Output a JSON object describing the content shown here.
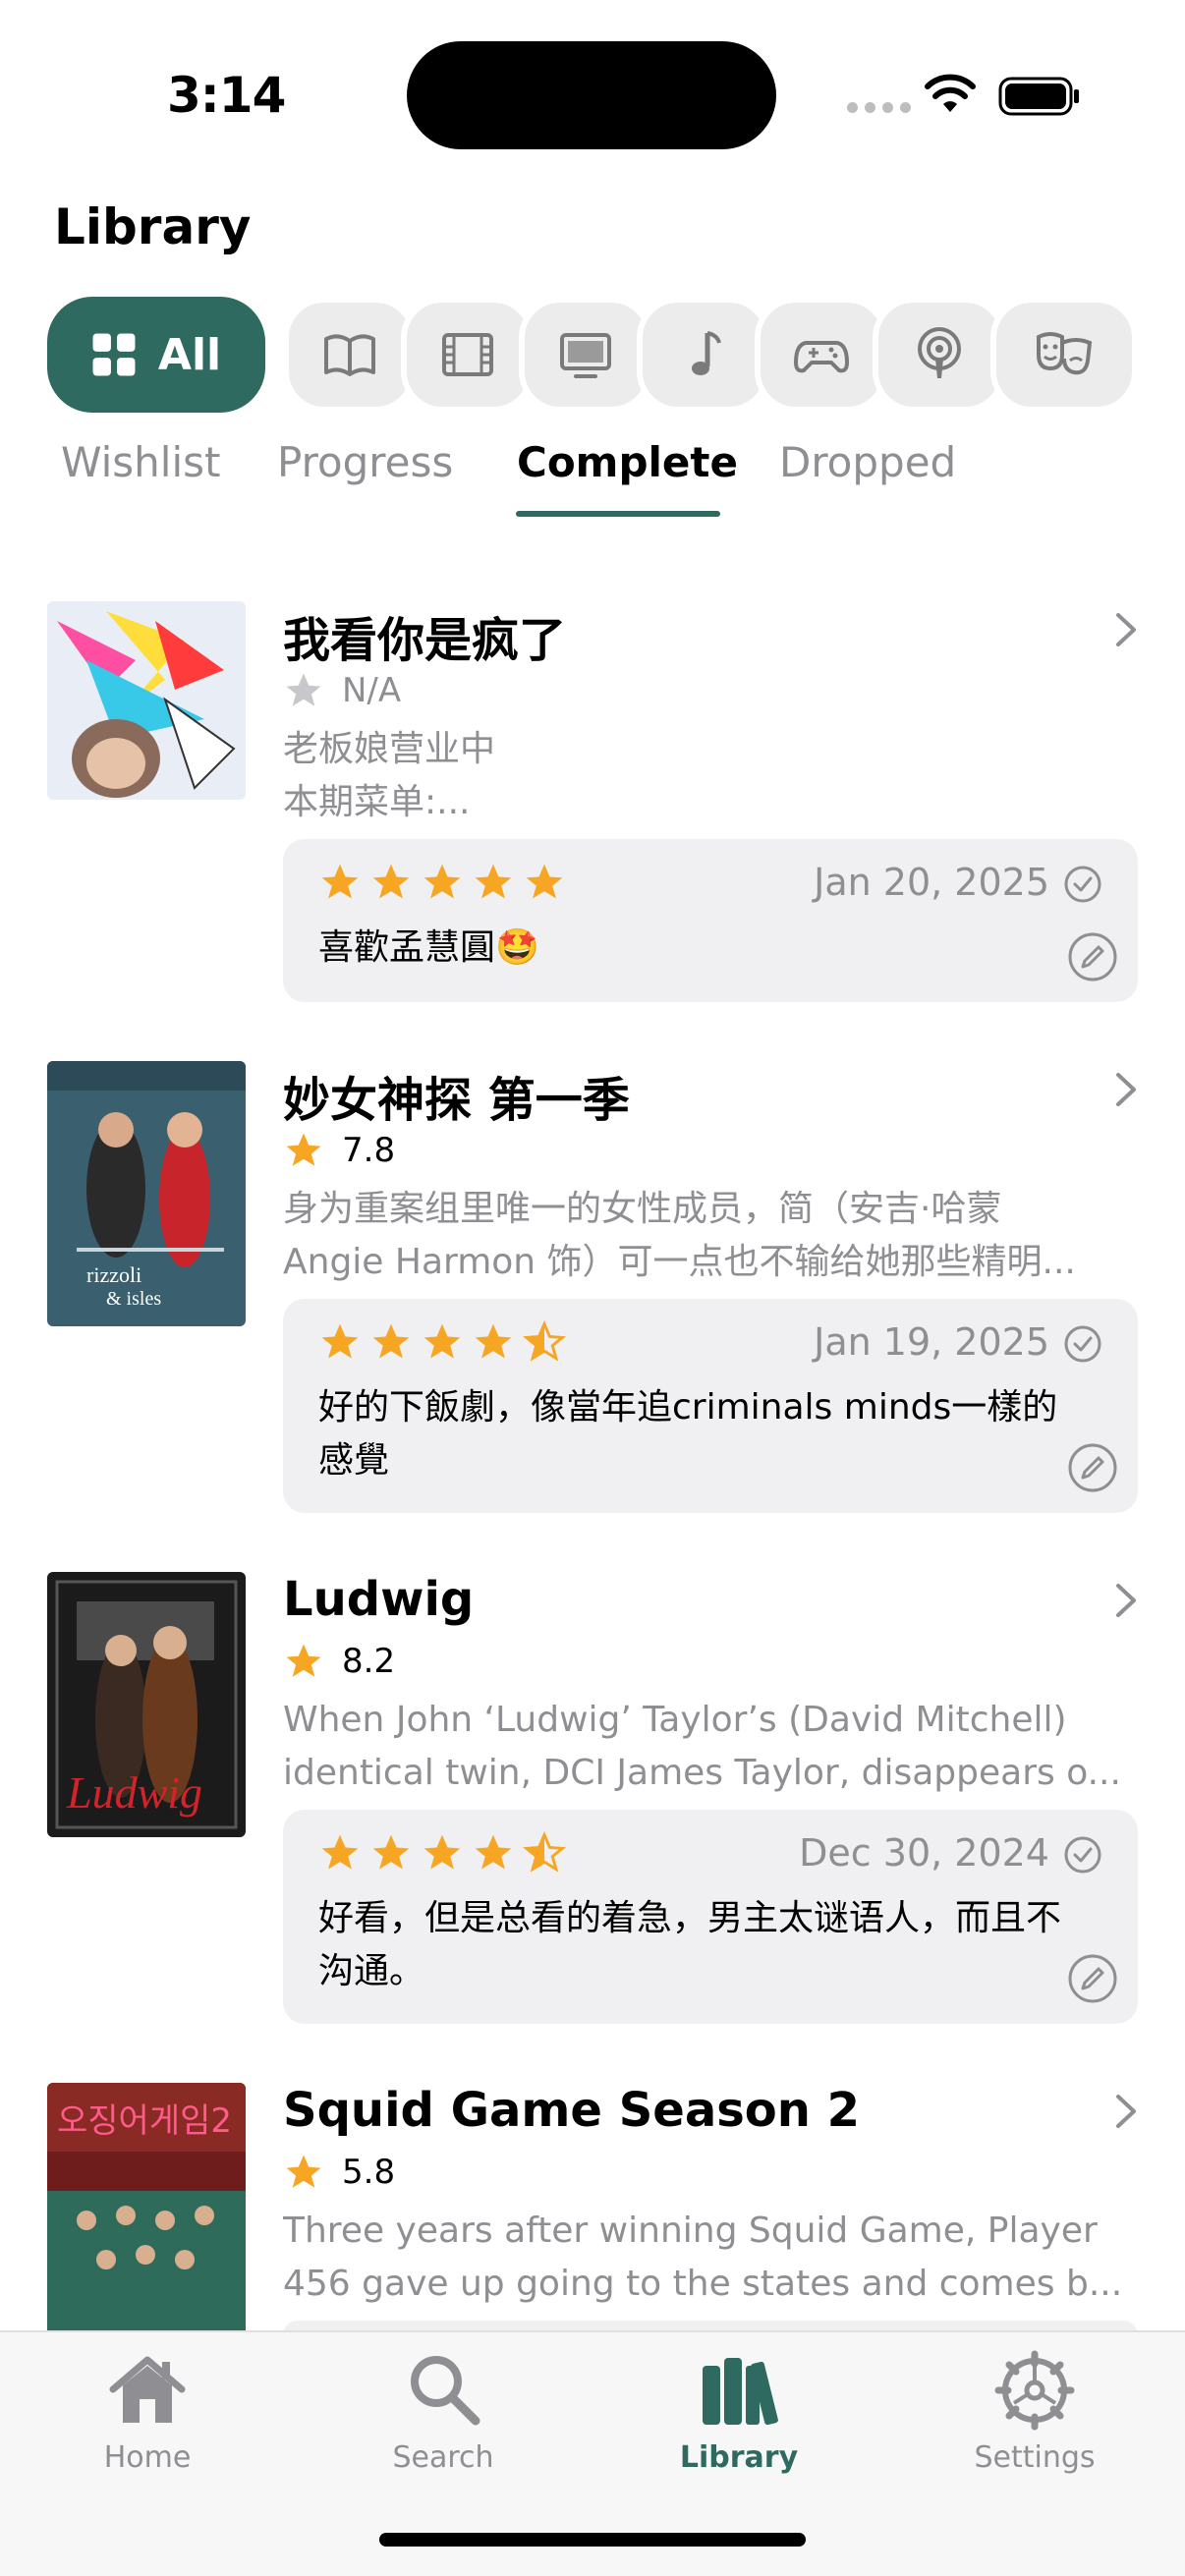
{
  "status_bar": {
    "time": "3:14"
  },
  "header": {
    "title": "Library"
  },
  "categories": {
    "all_label": "All",
    "items": [
      "book-icon",
      "film-icon",
      "tv-icon",
      "music-icon",
      "game-icon",
      "podcast-icon",
      "theater-icon"
    ]
  },
  "tabs": [
    "Wishlist",
    "Progress",
    "Complete",
    "Dropped"
  ],
  "active_tab": "Complete",
  "accent_color": "#2e6a5f",
  "star_color": "#f6a623",
  "items": [
    {
      "title": "我看你是疯了",
      "rating": "N/A",
      "desc_lines": [
        "老板娘营业中",
        "本期菜单:..."
      ],
      "review": {
        "stars": 5,
        "date": "Jan 20, 2025",
        "text": "喜歡孟慧圓🤩"
      }
    },
    {
      "title": "妙女神探 第一季",
      "rating": "7.8",
      "desc_lines": [
        "身为重案组里唯一的女性成员，简（安吉·哈蒙",
        "Angie Harmon 饰）可一点也不输给她那些精明..."
      ],
      "review": {
        "stars": 4.5,
        "date": "Jan 19, 2025",
        "text": "好的下飯劇，像當年追criminals minds一樣的感覺"
      }
    },
    {
      "title": "Ludwig",
      "rating": "8.2",
      "desc_lines": [
        "When John ‘Ludwig’ Taylor’s (David Mitchell)",
        "identical twin, DCI James Taylor, disappears o..."
      ],
      "review": {
        "stars": 4.5,
        "date": "Dec 30, 2024",
        "text": "好看，但是总看的着急，男主太谜语人，而且不沟通。"
      }
    },
    {
      "title": "Squid Game Season 2",
      "rating": "5.8",
      "desc_lines": [
        "Three years after winning Squid Game, Player",
        "456 gave up going to the states and comes b..."
      ]
    }
  ],
  "tabbar": {
    "items": [
      {
        "label": "Home",
        "icon": "house-icon"
      },
      {
        "label": "Search",
        "icon": "magnifier-icon"
      },
      {
        "label": "Library",
        "icon": "books-icon"
      },
      {
        "label": "Settings",
        "icon": "gear-icon"
      }
    ],
    "active": "Library"
  }
}
